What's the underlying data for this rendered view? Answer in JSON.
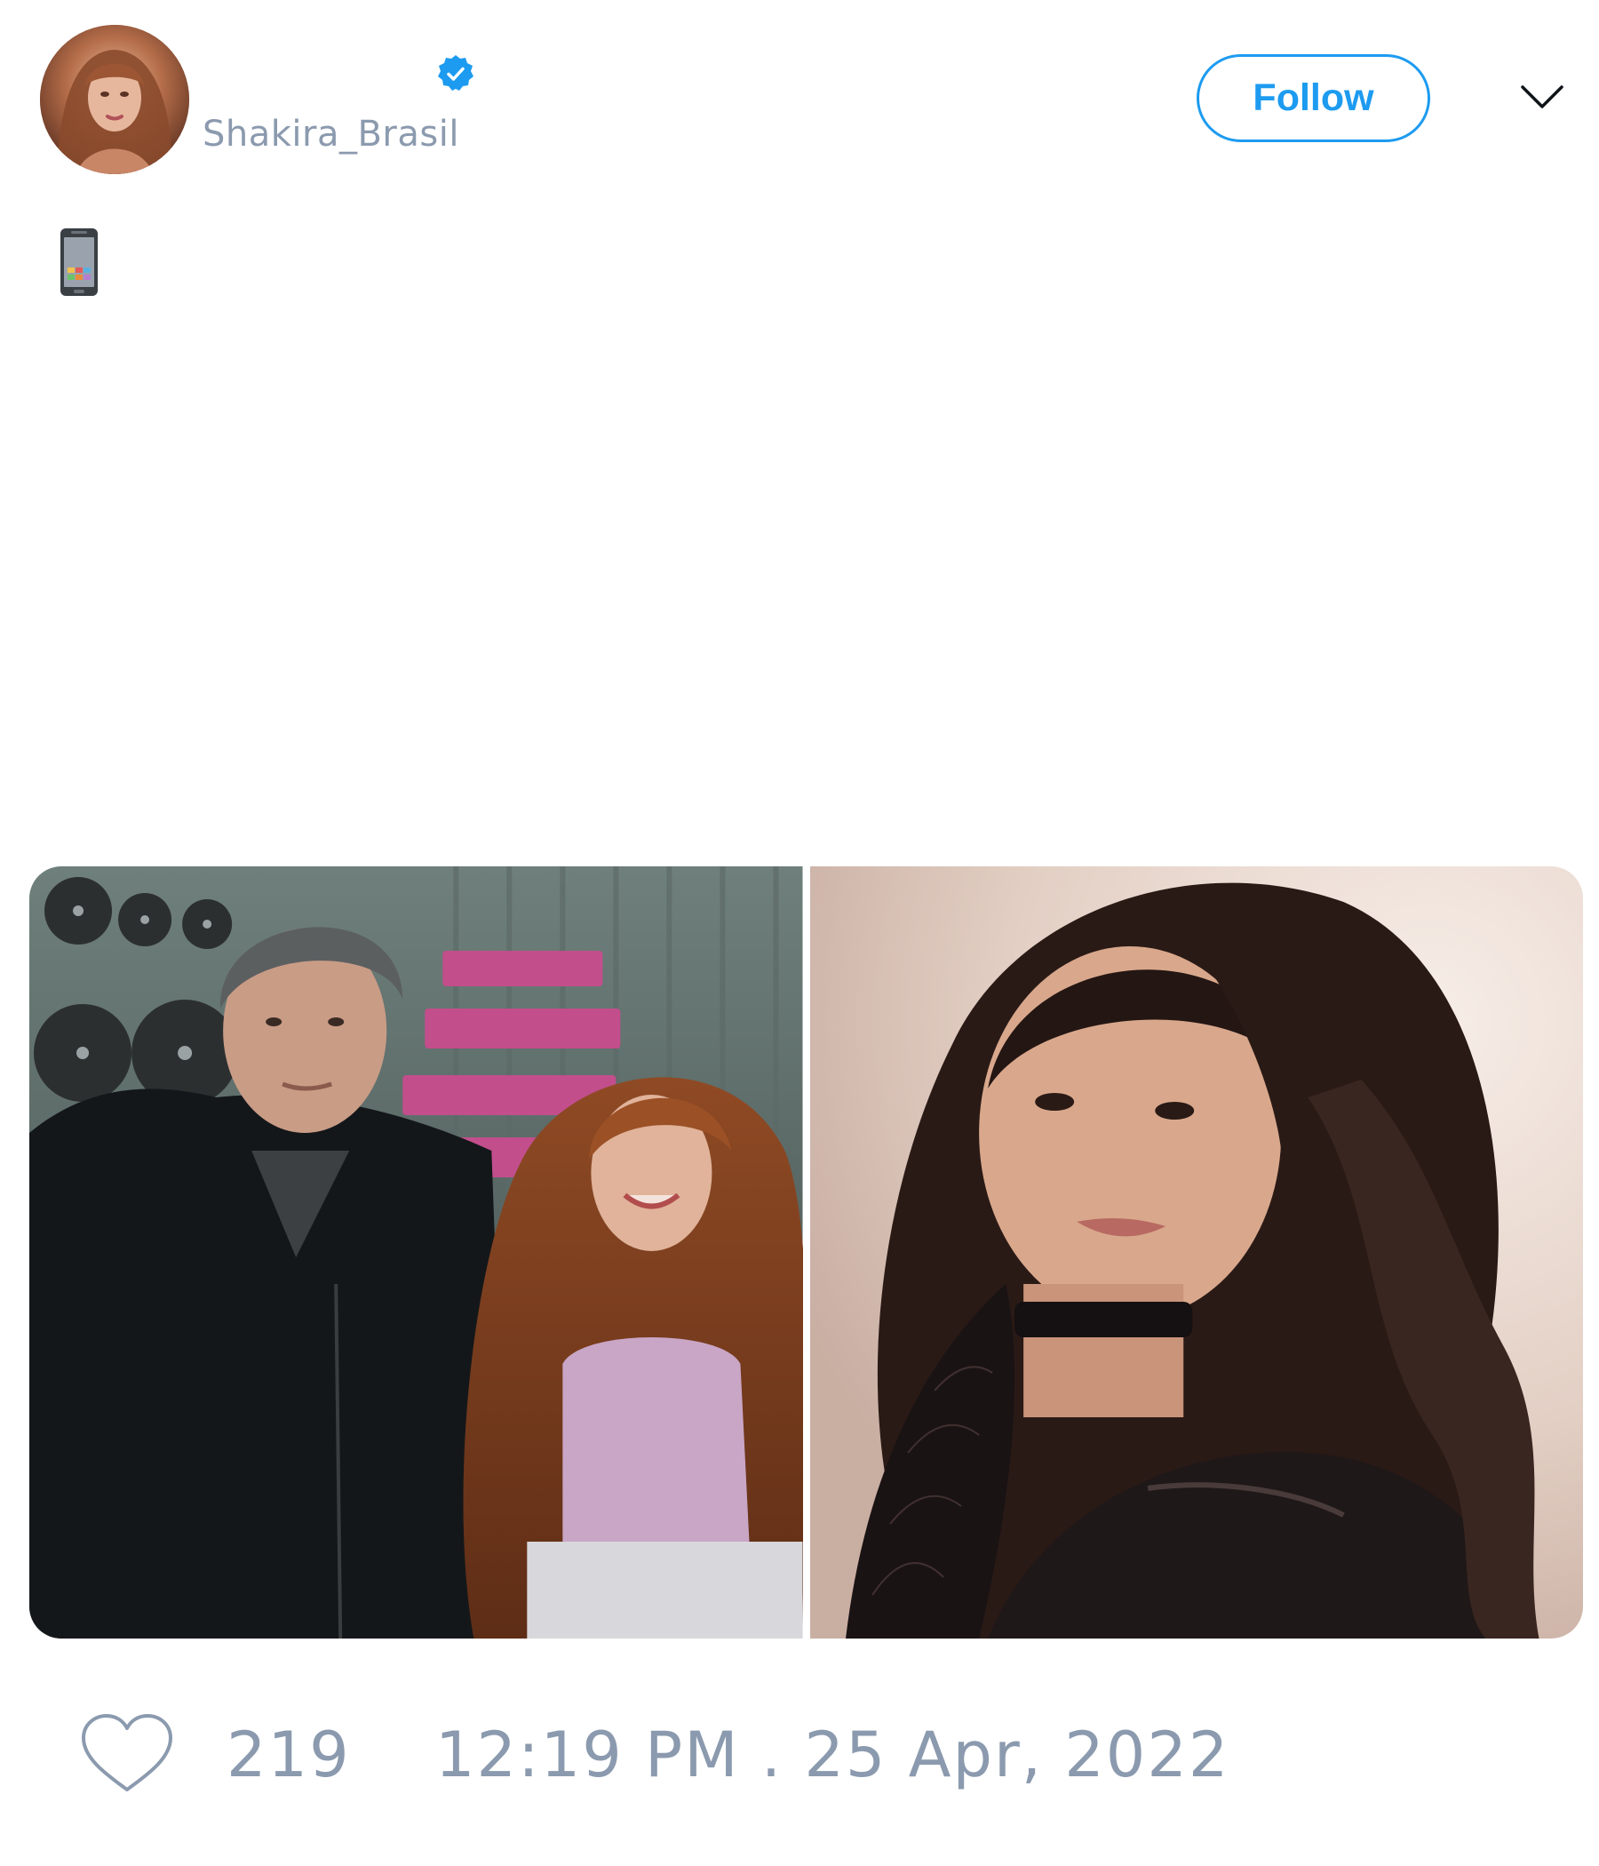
{
  "header": {
    "display_name": "",
    "handle": "Shakira_Brasil",
    "verified": true,
    "avatar_icon": "avatar-photo",
    "follow_label": "Follow",
    "menu_icon": "chevron-down-icon"
  },
  "tweet": {
    "text_icon": "mobile-phone-emoji",
    "media": [
      {
        "name": "media-photo-1",
        "alt": "photo"
      },
      {
        "name": "media-photo-2",
        "alt": "photo"
      }
    ]
  },
  "footer": {
    "like_icon": "heart-icon",
    "like_count": "219",
    "timestamp": "12:19 PM . 25 Apr, 2022"
  },
  "colors": {
    "accent": "#1d9bf0",
    "muted_text": "#8b9aae",
    "background": "#ffffff"
  }
}
